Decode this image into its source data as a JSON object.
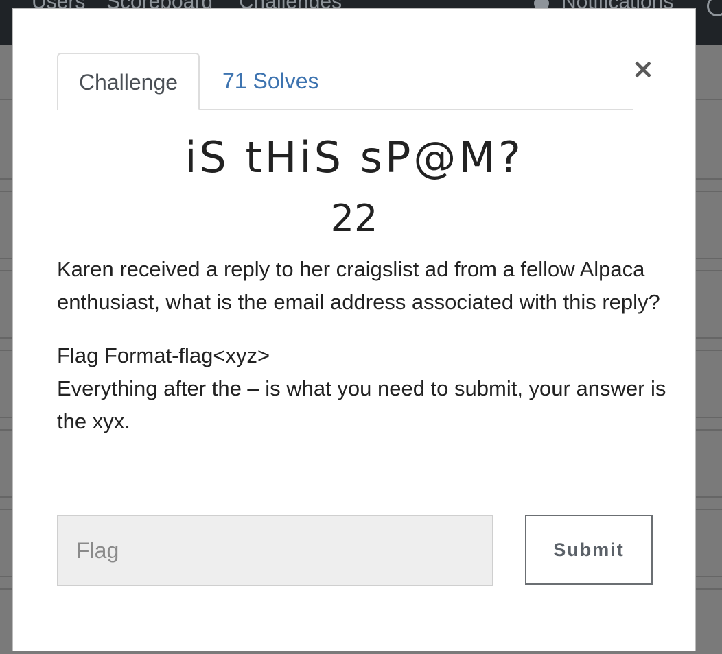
{
  "navbar": {
    "links": [
      "Users",
      "Scoreboard",
      "Challenges"
    ],
    "notifications_label": "Notifications"
  },
  "modal": {
    "tabs": [
      {
        "label": "Challenge",
        "active": true
      },
      {
        "label": "71 Solves",
        "active": false
      }
    ],
    "close_symbol": "×",
    "challenge_name": "iS tHiS sP@M?",
    "challenge_value": "22",
    "description": {
      "paragraph1": "Karen received a reply to her craigslist ad from a fellow Alpaca enthusiast, what is the email address associated with this reply?",
      "flag_format_line": "Flag Format-flag<xyz>",
      "instruction_line": "Everything after the – is what you need to submit, your answer is the xyx."
    },
    "flag_input": {
      "placeholder": "Flag",
      "value": ""
    },
    "submit_label": "Submit"
  },
  "colors": {
    "link": "#3e74b0",
    "navbar_bg": "#1f2327",
    "overlay_bg": "#7a7a7a",
    "input_bg": "#eeeeee"
  }
}
